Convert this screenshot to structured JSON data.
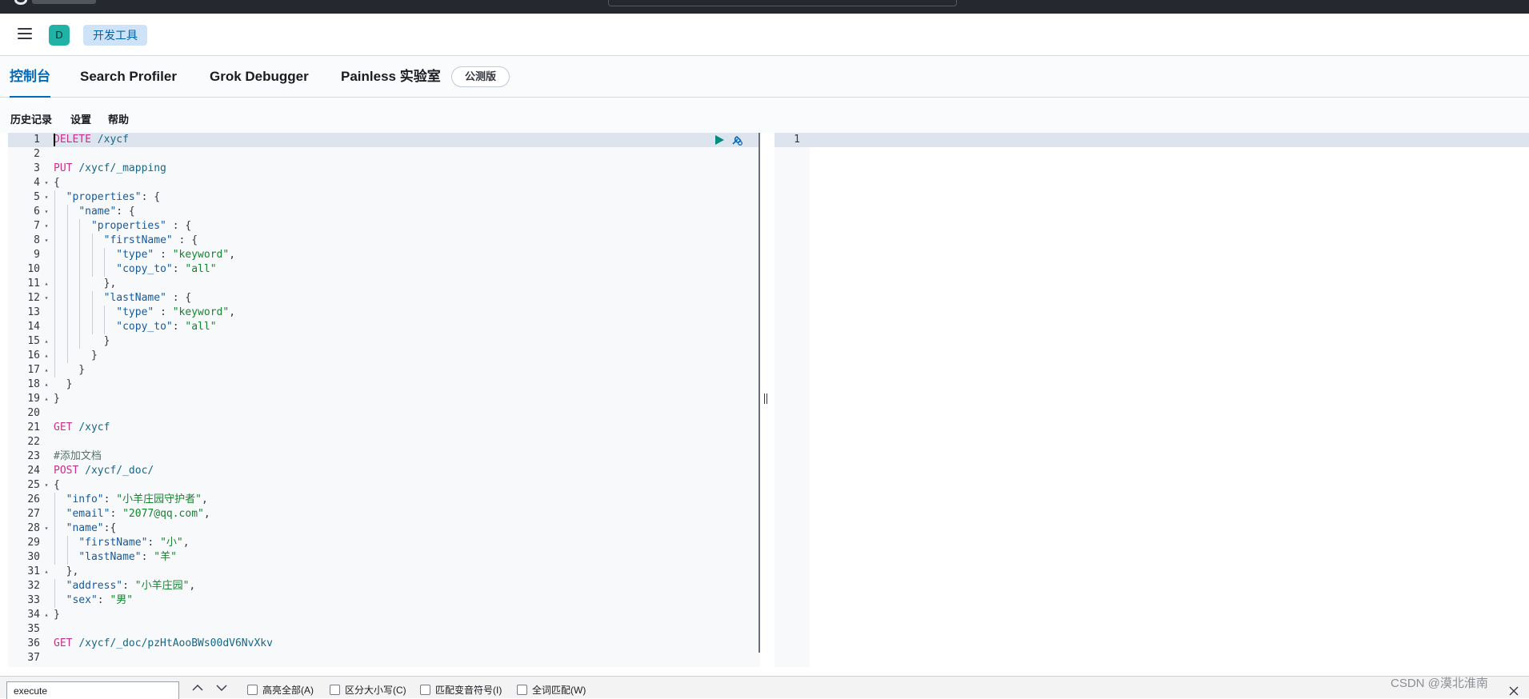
{
  "header": {
    "space_initial": "D",
    "breadcrumb": "开发工具"
  },
  "tabs": [
    {
      "label": "控制台",
      "active": true
    },
    {
      "label": "Search Profiler",
      "active": false
    },
    {
      "label": "Grok Debugger",
      "active": false
    },
    {
      "label": "Painless 实验室",
      "active": false
    }
  ],
  "beta_badge": "公测版",
  "subnav": [
    "历史记录",
    "设置",
    "帮助"
  ],
  "editor": {
    "active_line": 1,
    "lines": [
      {
        "n": "1",
        "fold": "",
        "code": "DELETE /xycf"
      },
      {
        "n": "2",
        "fold": "",
        "code": ""
      },
      {
        "n": "3",
        "fold": "",
        "code": "PUT /xycf/_mapping"
      },
      {
        "n": "4",
        "fold": "▾",
        "code": "{"
      },
      {
        "n": "5",
        "fold": "▾",
        "code": "  \"properties\": {"
      },
      {
        "n": "6",
        "fold": "▾",
        "code": "    \"name\": {"
      },
      {
        "n": "7",
        "fold": "▾",
        "code": "      \"properties\" : {"
      },
      {
        "n": "8",
        "fold": "▾",
        "code": "        \"firstName\" : {"
      },
      {
        "n": "9",
        "fold": "",
        "code": "          \"type\" : \"keyword\","
      },
      {
        "n": "10",
        "fold": "",
        "code": "          \"copy_to\": \"all\""
      },
      {
        "n": "11",
        "fold": "▴",
        "code": "        },"
      },
      {
        "n": "12",
        "fold": "▾",
        "code": "        \"lastName\" : {"
      },
      {
        "n": "13",
        "fold": "",
        "code": "          \"type\" : \"keyword\","
      },
      {
        "n": "14",
        "fold": "",
        "code": "          \"copy_to\": \"all\""
      },
      {
        "n": "15",
        "fold": "▴",
        "code": "        }"
      },
      {
        "n": "16",
        "fold": "▴",
        "code": "      }"
      },
      {
        "n": "17",
        "fold": "▴",
        "code": "    }"
      },
      {
        "n": "18",
        "fold": "▴",
        "code": "  }"
      },
      {
        "n": "19",
        "fold": "▴",
        "code": "}"
      },
      {
        "n": "20",
        "fold": "",
        "code": ""
      },
      {
        "n": "21",
        "fold": "",
        "code": "GET /xycf"
      },
      {
        "n": "22",
        "fold": "",
        "code": ""
      },
      {
        "n": "23",
        "fold": "",
        "code": "#添加文档"
      },
      {
        "n": "24",
        "fold": "",
        "code": "POST /xycf/_doc/"
      },
      {
        "n": "25",
        "fold": "▾",
        "code": "{"
      },
      {
        "n": "26",
        "fold": "",
        "code": "  \"info\": \"小羊庄园守护者\","
      },
      {
        "n": "27",
        "fold": "",
        "code": "  \"email\": \"2077@qq.com\","
      },
      {
        "n": "28",
        "fold": "▾",
        "code": "  \"name\":{"
      },
      {
        "n": "29",
        "fold": "",
        "code": "    \"firstName\": \"小\","
      },
      {
        "n": "30",
        "fold": "",
        "code": "    \"lastName\": \"羊\""
      },
      {
        "n": "31",
        "fold": "▴",
        "code": "  },"
      },
      {
        "n": "32",
        "fold": "",
        "code": "  \"address\": \"小羊庄园\","
      },
      {
        "n": "33",
        "fold": "",
        "code": "  \"sex\": \"男\""
      },
      {
        "n": "34",
        "fold": "▴",
        "code": "}"
      },
      {
        "n": "35",
        "fold": "",
        "code": ""
      },
      {
        "n": "36",
        "fold": "",
        "code": "GET /xycf/_doc/pzHtAooBWs00dV6NvXkv"
      },
      {
        "n": "37",
        "fold": "",
        "code": ""
      }
    ]
  },
  "output": {
    "lines": [
      {
        "n": "1"
      }
    ]
  },
  "findbar": {
    "value": "execute",
    "options": [
      "高亮全部(A)",
      "区分大小写(C)",
      "匹配变音符号(I)",
      "全词匹配(W)"
    ]
  },
  "watermark": "CSDN @漠北淮南",
  "colors": {
    "accent": "#006bb8",
    "method": "#c8308b",
    "string": "#14852f",
    "run": "#008d7e"
  }
}
